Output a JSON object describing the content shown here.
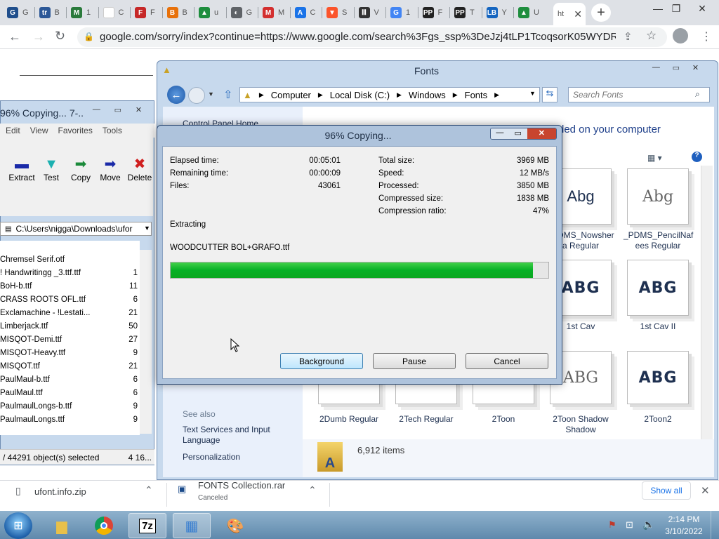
{
  "browser": {
    "tabs": [
      {
        "letter": "G",
        "color": "#1f4e8c",
        "label": "G"
      },
      {
        "letter": "tr",
        "color": "#2b5797",
        "label": "B"
      },
      {
        "letter": "M",
        "color": "#2a7a3b",
        "label": "1"
      },
      {
        "letter": "",
        "color": "#ffffff",
        "label": "C"
      },
      {
        "letter": "F",
        "color": "#c62828",
        "label": "F"
      },
      {
        "letter": "B",
        "color": "#e8710a",
        "label": "B"
      },
      {
        "letter": "▲",
        "color": "#1e8e3e",
        "label": "u"
      },
      {
        "letter": "◐",
        "color": "#5f6368",
        "label": "G"
      },
      {
        "letter": "M",
        "color": "#d32f2f",
        "label": "M"
      },
      {
        "letter": "A",
        "color": "#1a73e8",
        "label": "C"
      },
      {
        "letter": "▼",
        "color": "#fb542b",
        "label": "S"
      },
      {
        "letter": "Ⅲ",
        "color": "#333333",
        "label": "V"
      },
      {
        "letter": "G",
        "color": "#4285f4",
        "label": "1"
      },
      {
        "letter": "PP",
        "color": "#222222",
        "label": "F"
      },
      {
        "letter": "PP",
        "color": "#222222",
        "label": "T"
      },
      {
        "letter": "LB",
        "color": "#1565c0",
        "label": "Y"
      },
      {
        "letter": "▲",
        "color": "#1e8e3e",
        "label": "U"
      }
    ],
    "active_tab_label": "ht",
    "url": "google.com/sorry/index?continue=https://www.google.com/search%3Fgs_ssp%3DeJzj4tLP1TcoqsorK05WYDRgdGDw...",
    "new_tab_glyph": "+"
  },
  "fonts_window": {
    "title": "Fonts",
    "breadcrumb": [
      "Computer",
      "Local Disk (C:)",
      "Windows",
      "Fonts"
    ],
    "search_placeholder": "Search Fonts",
    "control_panel_home": "Control Panel Home",
    "heading_fragment": "led on your computer",
    "see_also": "See also",
    "links": [
      "Text Services and Input Language",
      "Personalization"
    ],
    "item_count": "6,912 items",
    "tiles_row1": [
      {
        "sample": "Abg",
        "name": "_PDMS_Nowsher a Regular",
        "style": "normal"
      },
      {
        "sample": "Abg",
        "name": "_PDMS_PencilNaf ees Regular",
        "style": "light"
      }
    ],
    "tiles_row2": [
      {
        "sample": "ABG",
        "name": "1st Cav",
        "style": "bold"
      },
      {
        "sample": "ABG",
        "name": "1st Cav II",
        "style": "bold"
      }
    ],
    "tiles_row3": [
      {
        "sample": "",
        "name": "2Dumb Regular",
        "style": "bold"
      },
      {
        "sample": "",
        "name": "2Tech Regular",
        "style": "bold"
      },
      {
        "sample": "ABG",
        "name": "2Toon",
        "style": "bold"
      },
      {
        "sample": "ABG",
        "name": "2Toon Shadow Shadow",
        "style": "light"
      },
      {
        "sample": "ABG",
        "name": "2Toon2",
        "style": "bold"
      }
    ]
  },
  "zip_window": {
    "title": "96% Copying... 7-...",
    "menu": [
      "Edit",
      "View",
      "Favorites",
      "Tools"
    ],
    "tools": [
      "Extract",
      "Test",
      "Copy",
      "Move",
      "Delete"
    ],
    "path": "C:\\Users\\nigga\\Downloads\\ufor",
    "column": "me",
    "files": [
      {
        "name": "Chremsel Serif.otf",
        "size": ""
      },
      {
        "name": "! Handwritingg _3.ttf.ttf",
        "size": "1"
      },
      {
        "name": "BoH-b.ttf",
        "size": "11"
      },
      {
        "name": "CRASS ROOTS OFL.ttf",
        "size": "6"
      },
      {
        "name": "Exclamachine - !Lestati...",
        "size": "21"
      },
      {
        "name": "Limberjack.ttf",
        "size": "50"
      },
      {
        "name": "MISQOT-Demi.ttf",
        "size": "27"
      },
      {
        "name": "MISQOT-Heavy.ttf",
        "size": "9"
      },
      {
        "name": "MISQOT.ttf",
        "size": "21"
      },
      {
        "name": "PaulMaul-b.ttf",
        "size": "6"
      },
      {
        "name": "PaulMaul.ttf",
        "size": "6"
      },
      {
        "name": "PaulmaulLongs-b.ttf",
        "size": "9"
      },
      {
        "name": "PaulmaulLongs.ttf",
        "size": "9"
      }
    ],
    "status_left": "/ 44291 object(s) selected",
    "status_right": "4 16..."
  },
  "copy_dialog": {
    "title": "96% Copying...",
    "left_stats": [
      {
        "label": "Elapsed time:",
        "value": "00:05:01"
      },
      {
        "label": "Remaining time:",
        "value": "00:00:09"
      },
      {
        "label": "Files:",
        "value": "43061"
      }
    ],
    "right_stats": [
      {
        "label": "Total size:",
        "value": "3969 MB"
      },
      {
        "label": "Speed:",
        "value": "12 MB/s"
      },
      {
        "label": "Processed:",
        "value": "3850 MB"
      },
      {
        "label": "Compressed size:",
        "value": "1838 MB"
      },
      {
        "label": "Compression ratio:",
        "value": "47%"
      }
    ],
    "status": "Extracting",
    "current_file": "WOODCUTTER BOL+GRAFO.ttf",
    "progress": 0.96,
    "buttons": {
      "background": "Background",
      "pause": "Pause",
      "cancel": "Cancel"
    }
  },
  "downloads": {
    "items": [
      {
        "name": "ufont.info.zip",
        "status": ""
      },
      {
        "name": "FONTS Collection.rar",
        "status": "Canceled"
      }
    ],
    "show_all": "Show all"
  },
  "taskbar": {
    "time": "2:14 PM",
    "date": "3/10/2022",
    "apps": [
      "file-explorer",
      "chrome",
      "7zip",
      "control-panel",
      "paint"
    ]
  }
}
